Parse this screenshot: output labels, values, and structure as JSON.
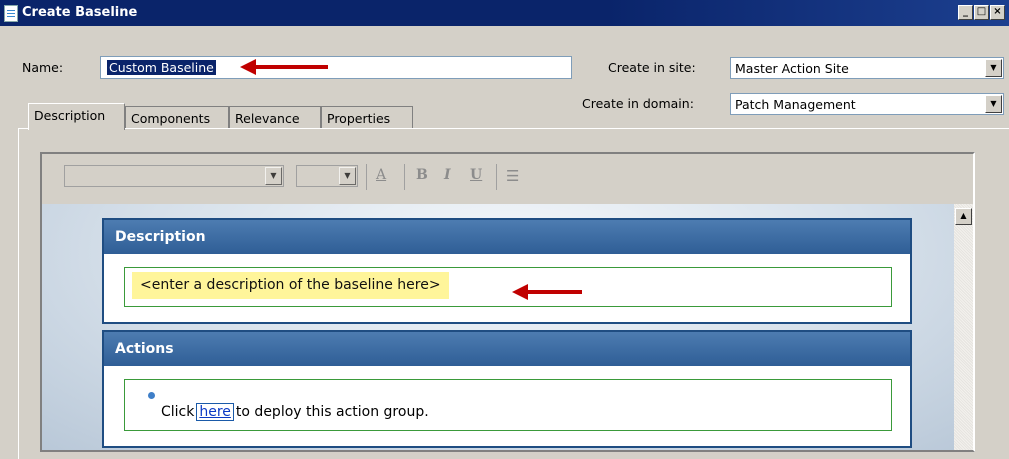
{
  "window": {
    "title": "Create Baseline"
  },
  "form": {
    "name_label": "Name:",
    "name_value": "Custom Baseline",
    "site_label": "Create in site:",
    "site_value": "Master Action Site",
    "domain_label": "Create in domain:",
    "domain_value": "Patch Management"
  },
  "tabs": [
    {
      "label": "Description",
      "active": true
    },
    {
      "label": "Components",
      "active": false
    },
    {
      "label": "Relevance",
      "active": false
    },
    {
      "label": "Properties",
      "active": false
    }
  ],
  "editor": {
    "toolbar": {
      "bold": "B",
      "italic": "I",
      "underline": "U",
      "font_color": "A"
    },
    "description_panel": {
      "heading": "Description",
      "placeholder": "<enter a description of the baseline here>"
    },
    "actions_panel": {
      "heading": "Actions",
      "text_before": "Click",
      "link": "here",
      "text_after": "to deploy this action group."
    }
  },
  "colors": {
    "titlebar": "#0a246a",
    "panel_header": "#3a6aa3",
    "highlight": "#fff59a",
    "arrow": "#c00000",
    "green_border": "#3a9a3a"
  }
}
